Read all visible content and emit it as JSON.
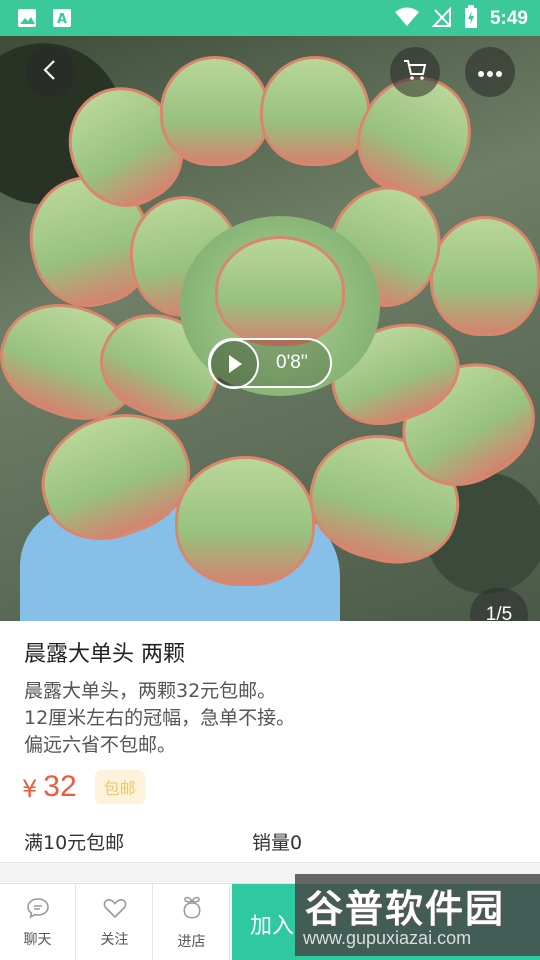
{
  "status_bar": {
    "time": "5:49"
  },
  "hero": {
    "video_duration": "0'8''",
    "pager": "1/5"
  },
  "product": {
    "title": "晨露大单头 两颗",
    "description": [
      "晨露大单头，两颗32元包邮。",
      "12厘米左右的冠幅，急单不接。",
      "偏远六省不包邮。"
    ],
    "currency": "¥",
    "price": "32",
    "badge": "包邮",
    "shipping_rule": "满10元包邮",
    "sales": "销量0"
  },
  "bottom_bar": {
    "tabs": [
      {
        "label": "聊天",
        "icon": "chat-icon"
      },
      {
        "label": "关注",
        "icon": "heart-icon"
      },
      {
        "label": "进店",
        "icon": "shop-icon"
      }
    ],
    "cart_label": "加入"
  },
  "watermark": {
    "title": "谷普软件园",
    "url": "www.gupuxiazai.com"
  },
  "colors": {
    "accent": "#3bc99a",
    "cart_button": "#2fc9a1",
    "price": "#f05a3c",
    "badge_bg": "#fdf3dc",
    "badge_text": "#f2c667"
  }
}
